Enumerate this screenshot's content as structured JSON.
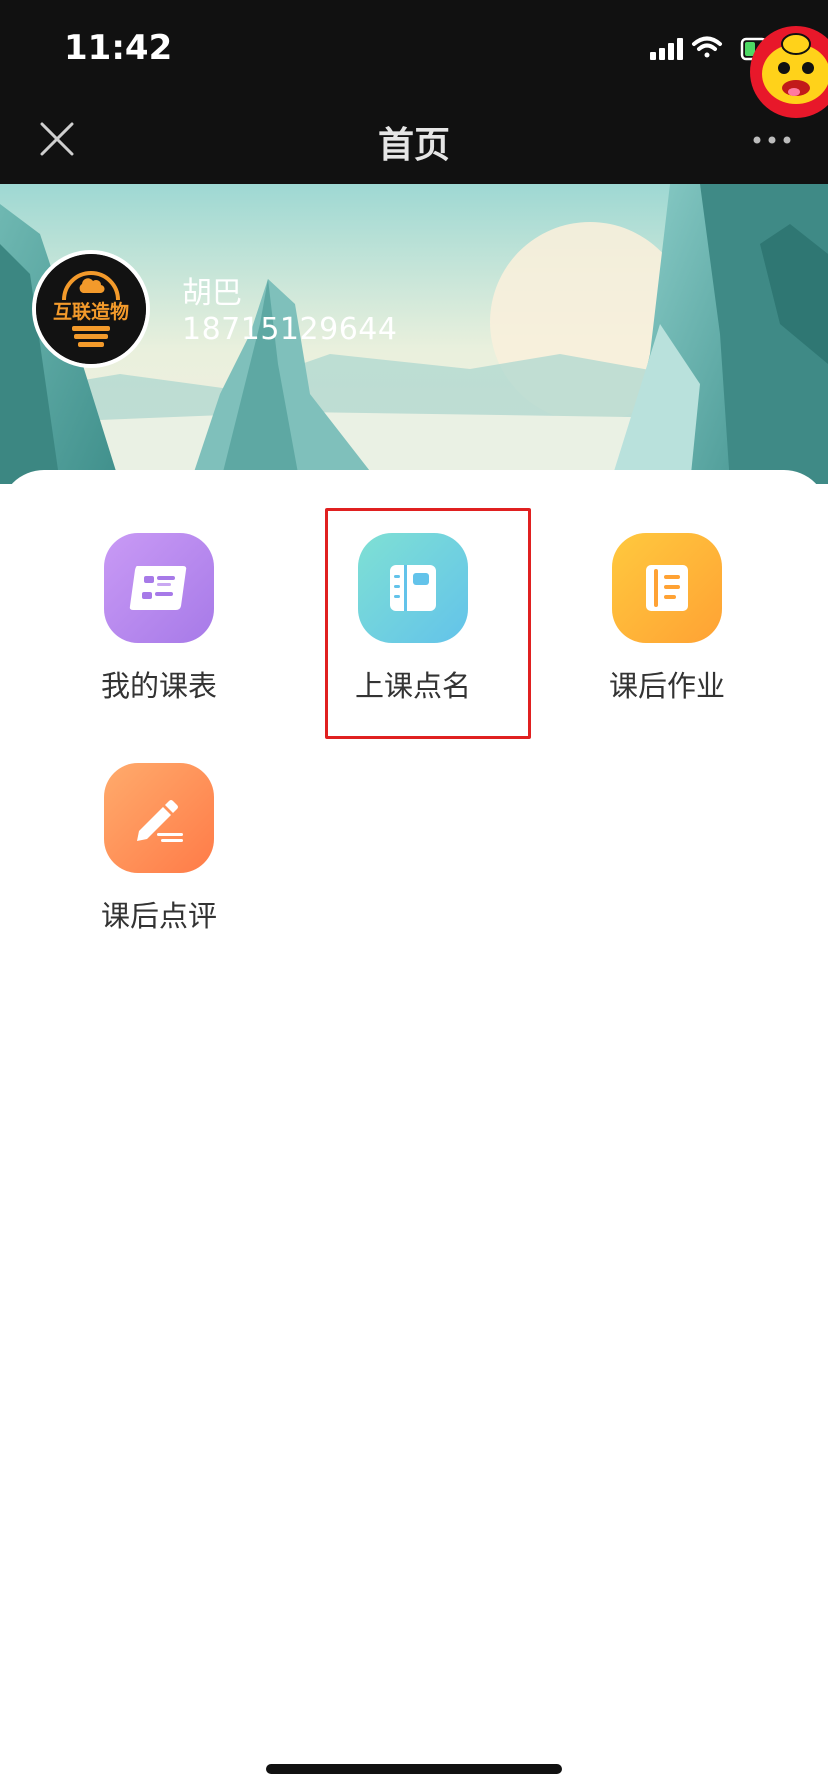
{
  "status_bar": {
    "time": "11:42"
  },
  "nav": {
    "title": "首页"
  },
  "user": {
    "name": "胡巴",
    "phone": "18715129644",
    "logo_text": "互联造物"
  },
  "menu": {
    "items": [
      {
        "label": "我的课表",
        "icon": "schedule-icon",
        "color": "#B58AF0"
      },
      {
        "label": "上课点名",
        "icon": "roll-call-icon",
        "color": "#6CCFE0"
      },
      {
        "label": "课后作业",
        "icon": "homework-icon",
        "color": "#FFB23F"
      },
      {
        "label": "课后点评",
        "icon": "review-pencil-icon",
        "color": "#FF8A5A"
      }
    ]
  },
  "colors": {
    "topbar": "#111111",
    "highlight": "#E02020"
  }
}
